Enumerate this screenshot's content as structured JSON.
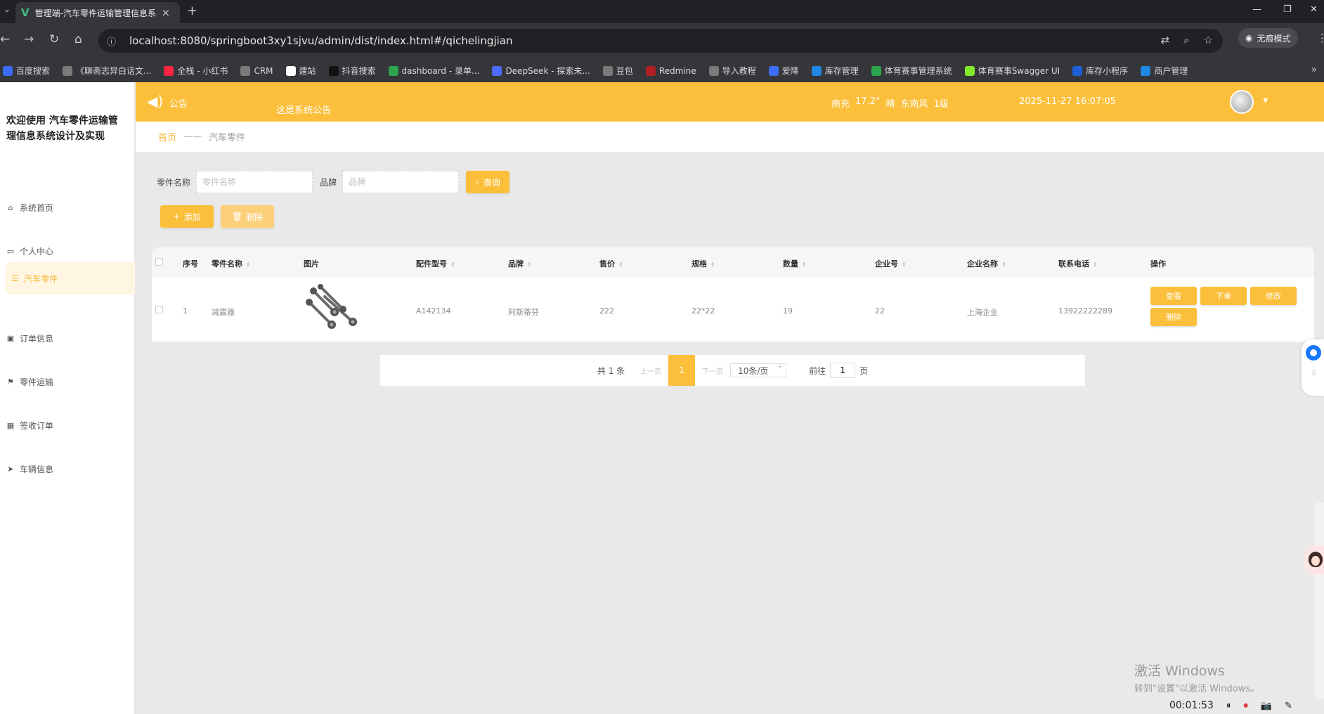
{
  "browser": {
    "tab_title": "管理端-汽车零件运输管理信息系统设计及实现",
    "tab_icon": "vue-logo-icon",
    "url": "localhost:8080/springboot3xy1sjvu/admin/dist/index.html#/qichelingjian",
    "incognito_label": "无痕模式",
    "bookmarks": [
      {
        "label": "百度搜索",
        "color": "#3b6cf6"
      },
      {
        "label": "《聊斋志异白话文...",
        "color": "#7a7a7a"
      },
      {
        "label": "全栈 - 小红书",
        "color": "#ff2442"
      },
      {
        "label": "CRM",
        "color": "#7a7a7a"
      },
      {
        "label": "建站",
        "color": "#ffffff"
      },
      {
        "label": "抖音搜索",
        "color": "#111111"
      },
      {
        "label": "dashboard - 录单...",
        "color": "#2da44e"
      },
      {
        "label": "DeepSeek - 探索未...",
        "color": "#4d6bfe"
      },
      {
        "label": "豆包",
        "color": "#7a7a7a"
      },
      {
        "label": "Redmine",
        "color": "#b32024"
      },
      {
        "label": "导入教程",
        "color": "#7a7a7a"
      },
      {
        "label": "爱降",
        "color": "#3b6cf6"
      },
      {
        "label": "库存管理",
        "color": "#1e88e5"
      },
      {
        "label": "体育赛事管理系统",
        "color": "#2da44e"
      },
      {
        "label": "体育赛事Swagger UI",
        "color": "#85ea2d"
      },
      {
        "label": "库存小程序",
        "color": "#1e5fd8"
      },
      {
        "label": "商户管理",
        "color": "#1e88e5"
      }
    ]
  },
  "sidebar": {
    "welcome": "欢迎使用 汽车零件运输管理信息系统设计及实现",
    "items": [
      {
        "label": "系统首页",
        "icon": "home-icon"
      },
      {
        "label": "个人中心",
        "icon": "id-card-icon"
      },
      {
        "label": "汽车零件",
        "icon": "list-icon"
      },
      {
        "label": "订单信息",
        "icon": "clipboard-icon"
      },
      {
        "label": "零件运输",
        "icon": "flag-icon"
      },
      {
        "label": "签收订单",
        "icon": "grid-icon"
      },
      {
        "label": "车辆信息",
        "icon": "send-icon"
      }
    ]
  },
  "topbar": {
    "notice_label": "公告",
    "marquee": "这是系统公告",
    "weather": {
      "city": "南充",
      "temp": "17.2°",
      "condition": "晴",
      "wind": "东南风",
      "level": "1级"
    },
    "datetime": "2025-11-27 16:07:05"
  },
  "breadcrumb": {
    "home": "首页",
    "current": "汽车零件"
  },
  "search": {
    "name_label": "零件名称",
    "name_placeholder": "零件名称",
    "brand_label": "品牌",
    "brand_placeholder": "品牌",
    "query_button": "查询"
  },
  "actions": {
    "add": "添加",
    "delete": "删除"
  },
  "table": {
    "headers": {
      "index": "序号",
      "name": "零件名称",
      "image": "图片",
      "model": "配件型号",
      "brand": "品牌",
      "price": "售价",
      "spec": "规格",
      "quantity": "数量",
      "company_no": "企业号",
      "company_name": "企业名称",
      "phone": "联系电话",
      "ops": "操作"
    },
    "rows": [
      {
        "index": "1",
        "name": "减震器",
        "model": "A142134",
        "brand": "阿斯蒂芬",
        "price": "222",
        "spec": "22*22",
        "quantity": "19",
        "company_no": "22",
        "company_name": "上海企业",
        "phone": "13922222289",
        "ops": {
          "view": "查看",
          "order": "下单",
          "edit": "修改",
          "delete": "删除"
        }
      }
    ]
  },
  "pagination": {
    "total": "共 1 条",
    "prev": "上一页",
    "current": "1",
    "next": "下一页",
    "page_size": "10条/页",
    "goto_prefix": "前往",
    "goto_value": "1",
    "goto_suffix": "页"
  },
  "watermark": {
    "line1": "激活 Windows",
    "line2": "转到\"设置\"以激活 Windows。"
  },
  "recorder": {
    "time": "00:01:53"
  },
  "colors": {
    "accent": "#fbbf3b",
    "sidebar_active_bg": "#fff6e2"
  }
}
